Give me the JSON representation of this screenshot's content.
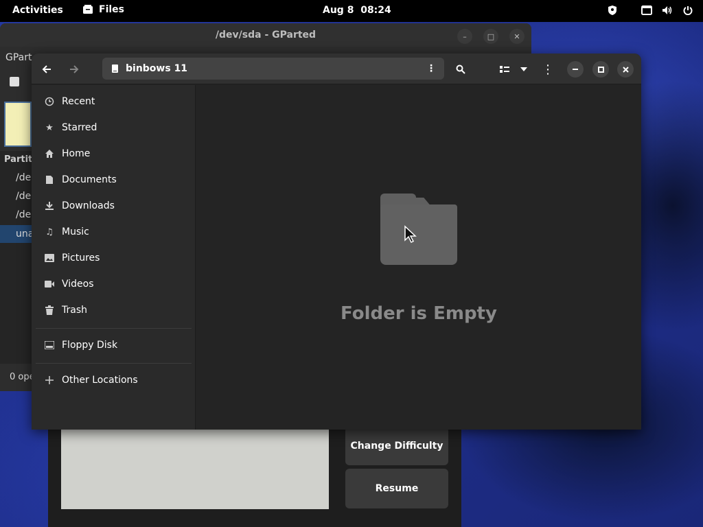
{
  "topbar": {
    "activities": "Activities",
    "app_name": "Files",
    "date": "Aug 8",
    "time": "08:24"
  },
  "gparted": {
    "title": "/dev/sda - GParted",
    "menu_partial": "GPart",
    "list_header": "Partiti",
    "rows": [
      "/de",
      "/de",
      "/de",
      "una"
    ],
    "status": "0 ope"
  },
  "game": {
    "change_difficulty": "Change Difficulty",
    "resume": "Resume"
  },
  "files": {
    "location": "binbows 11",
    "sidebar": [
      {
        "label": "Recent",
        "icon": "clock-icon"
      },
      {
        "label": "Starred",
        "icon": "star-icon"
      },
      {
        "label": "Home",
        "icon": "home-icon"
      },
      {
        "label": "Documents",
        "icon": "document-icon"
      },
      {
        "label": "Downloads",
        "icon": "download-icon"
      },
      {
        "label": "Music",
        "icon": "music-icon"
      },
      {
        "label": "Pictures",
        "icon": "picture-icon"
      },
      {
        "label": "Videos",
        "icon": "video-icon"
      },
      {
        "label": "Trash",
        "icon": "trash-icon"
      }
    ],
    "devices": [
      {
        "label": "Floppy Disk",
        "icon": "drive-icon"
      }
    ],
    "other_locations": "Other Locations",
    "empty_message": "Folder is Empty"
  },
  "colors": {
    "window_bg": "#242424",
    "sidebar_bg": "#2a2a2a",
    "header_bg": "#303030",
    "selection": "#22456e"
  }
}
